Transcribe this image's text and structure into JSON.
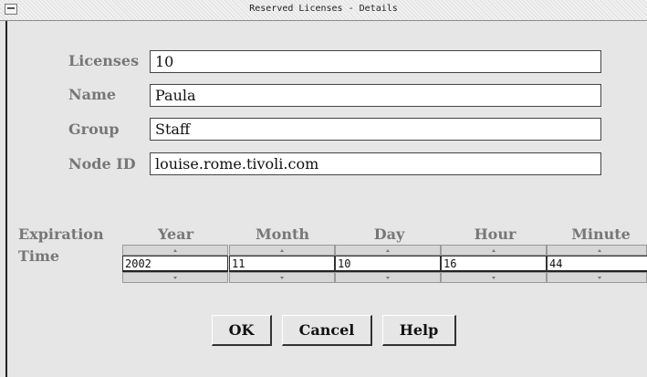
{
  "window": {
    "title": "Reserved Licenses - Details"
  },
  "fields": {
    "licenses": {
      "label": "Licenses",
      "value": "10"
    },
    "name": {
      "label": "Name",
      "value": "Paula"
    },
    "group": {
      "label": "Group",
      "value": "Staff"
    },
    "node_id": {
      "label": "Node ID",
      "value": "louise.rome.tivoli.com"
    }
  },
  "expiration": {
    "label_line1": "Expiration",
    "label_line2": "Time",
    "columns": [
      {
        "label": "Year",
        "value": "2002"
      },
      {
        "label": "Month",
        "value": "11"
      },
      {
        "label": "Day",
        "value": "10"
      },
      {
        "label": "Hour",
        "value": "16"
      },
      {
        "label": "Minute",
        "value": "44"
      }
    ]
  },
  "buttons": {
    "ok": "OK",
    "cancel": "Cancel",
    "help": "Help"
  },
  "icons": {
    "window_menu": "window-menu-icon",
    "spin_up": "arrow-up-icon",
    "spin_down": "arrow-down-icon"
  }
}
